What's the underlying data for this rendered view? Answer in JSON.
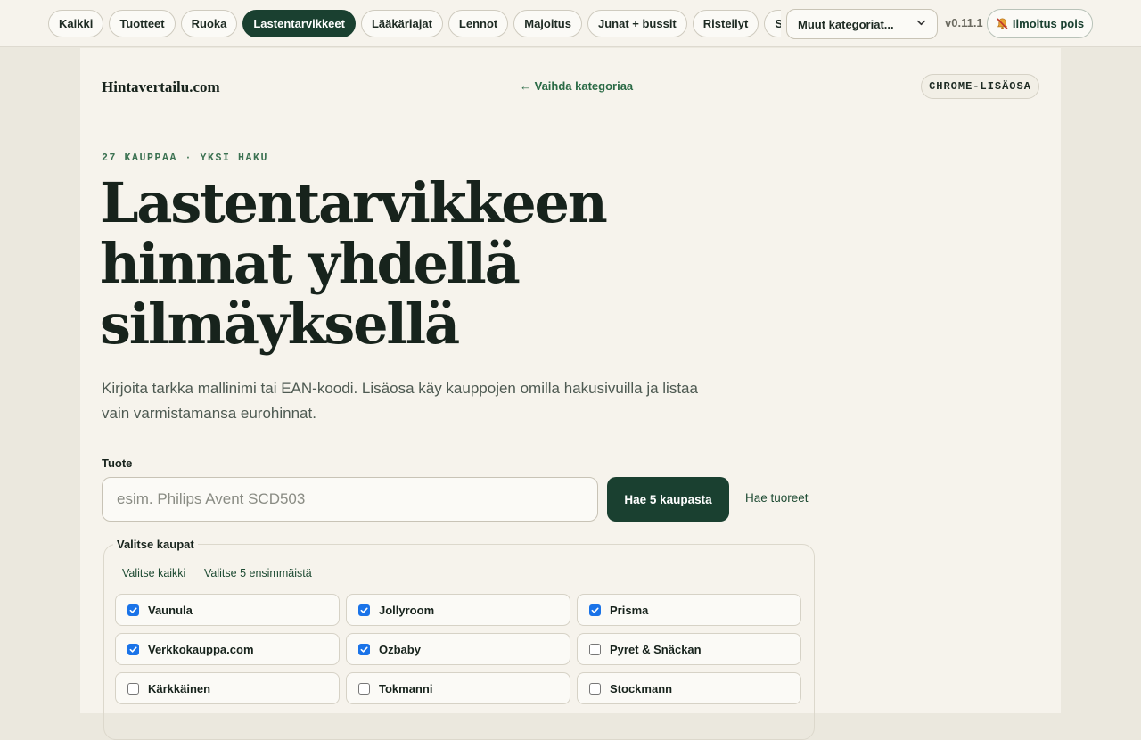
{
  "topbar": {
    "chips": [
      {
        "label": "Kaikki",
        "active": false
      },
      {
        "label": "Tuotteet",
        "active": false
      },
      {
        "label": "Ruoka",
        "active": false
      },
      {
        "label": "Lastentarvikkeet",
        "active": true
      },
      {
        "label": "Lääkäriajat",
        "active": false
      },
      {
        "label": "Lennot",
        "active": false
      },
      {
        "label": "Majoitus",
        "active": false
      },
      {
        "label": "Junat + bussit",
        "active": false
      },
      {
        "label": "Risteilyt",
        "active": false
      },
      {
        "label": "Sähkö",
        "active": false
      }
    ],
    "category_select": "Muut kategoriat...",
    "version": "v0.11.1",
    "notify_label": "Ilmoitus pois"
  },
  "header": {
    "brand": "Hintavertailu.com",
    "switch_link": "← Vaihda kategoriaa",
    "ext_badge": "CHROME-LISÄOSA"
  },
  "hero": {
    "eyebrow": "27 KAUPPAA · YKSI HAKU",
    "title": "Lastentarvikkeen hinnat yhdellä silmäyksellä",
    "lede": "Kirjoita tarkka mallinimi tai EAN-koodi. Lisäosa käy kauppojen omilla hakusivuilla ja listaa vain varmistamansa eurohinnat."
  },
  "search": {
    "label": "Tuote",
    "value": "",
    "placeholder": "esim. Philips Avent SCD503",
    "button": "Hae 5 kaupasta",
    "fresh_link": "Hae tuoreet"
  },
  "stores": {
    "legend": "Valitse kaupat",
    "select_all": "Valitse kaikki",
    "select_first5": "Valitse 5 ensimmäistä",
    "items": [
      {
        "name": "Vaunula",
        "checked": true
      },
      {
        "name": "Jollyroom",
        "checked": true
      },
      {
        "name": "Prisma",
        "checked": true
      },
      {
        "name": "Verkkokauppa.com",
        "checked": true
      },
      {
        "name": "Ozbaby",
        "checked": true
      },
      {
        "name": "Pyret & Snäckan",
        "checked": false
      },
      {
        "name": "Kärkkäinen",
        "checked": false
      },
      {
        "name": "Tokmanni",
        "checked": false
      },
      {
        "name": "Stockmann",
        "checked": false
      }
    ]
  },
  "colors": {
    "accent": "#1a4030",
    "link": "#2a6a45",
    "checkbox": "#1a73e8",
    "page_bg": "#ebe8de",
    "panel_bg": "#f6f3ec"
  },
  "icons": {
    "notify": "bell-off-icon",
    "select": "chevron-down-icon",
    "checkbox": "check-icon"
  }
}
